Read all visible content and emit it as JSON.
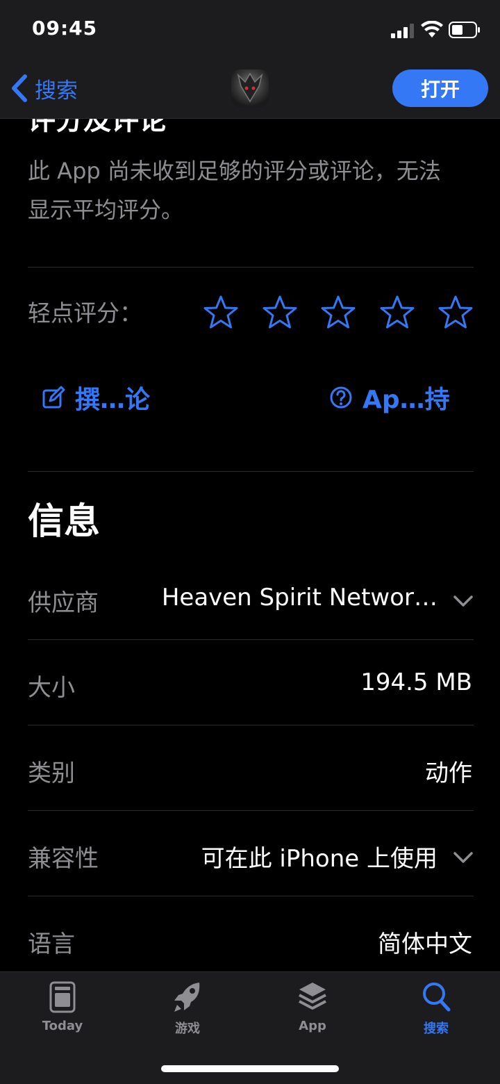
{
  "status_bar": {
    "time": "09:45"
  },
  "nav": {
    "back_label": "搜索",
    "open_label": "打开"
  },
  "ratings": {
    "partial_heading": "评分及评论",
    "note": "此 App 尚未收到足够的评分或评论，无法显示平均评分。",
    "tap_to_rate_label": "轻点评分：",
    "star_count": 5,
    "write_review_label": "撰…论",
    "support_label": "Ap…持"
  },
  "info": {
    "title": "信息",
    "rows": [
      {
        "label": "供应商",
        "value": "Heaven Spirit Networ…",
        "expandable": true
      },
      {
        "label": "大小",
        "value": "194.5 MB",
        "expandable": false
      },
      {
        "label": "类别",
        "value": "动作",
        "expandable": false
      },
      {
        "label": "兼容性",
        "value": "可在此 iPhone 上使用",
        "expandable": true
      },
      {
        "label": "语言",
        "value": "简体中文",
        "expandable": false
      }
    ]
  },
  "tab_bar": {
    "tabs": [
      {
        "label": "Today",
        "icon": "today-icon",
        "active": false
      },
      {
        "label": "游戏",
        "icon": "rocket-icon",
        "active": false
      },
      {
        "label": "App",
        "icon": "layers-icon",
        "active": false
      },
      {
        "label": "搜索",
        "icon": "search-icon",
        "active": true
      }
    ]
  },
  "colors": {
    "accent": "#3478f6",
    "background": "#000000",
    "bar": "#1c1c1e",
    "secondary_text": "#8e8e93"
  }
}
